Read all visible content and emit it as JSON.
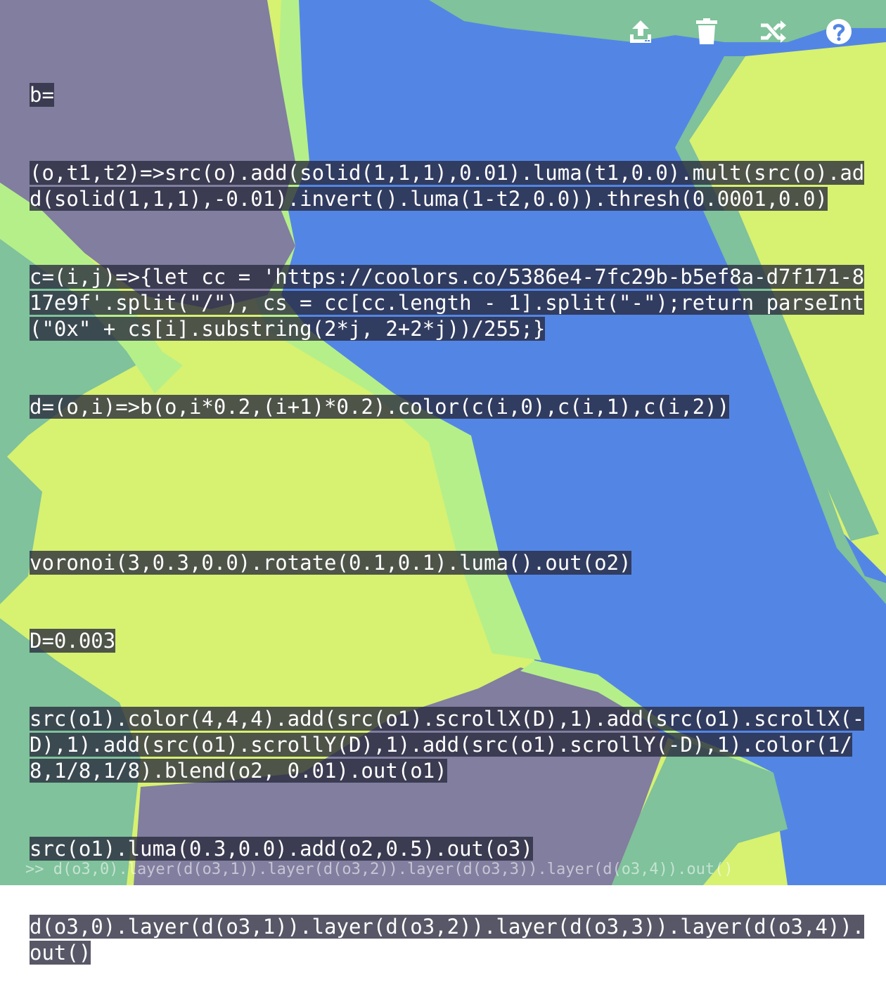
{
  "toolbar": {
    "icons": [
      "upload-icon",
      "trash-icon",
      "shuffle-icon",
      "help-icon"
    ]
  },
  "editor": {
    "lines": [
      "b=",
      "(o,t1,t2)=>src(o).add(solid(1,1,1),0.01).luma(t1,0.0).mult(src(o).add(solid(1,1,1),-0.01).invert().luma(1-t2,0.0)).thresh(0.0001,0.0)",
      "c=(i,j)=>{let cc = 'https://coolors.co/5386e4-7fc29b-b5ef8a-d7f171-817e9f'.split(\"/\"), cs = cc[cc.length - 1].split(\"-\");return parseInt(\"0x\" + cs[i].substring(2*j, 2+2*j))/255;}",
      "d=(o,i)=>b(o,i*0.2,(i+1)*0.2).color(c(i,0),c(i,1),c(i,2))",
      "",
      "voronoi(3,0.3,0.0).rotate(0.1,0.1).luma().out(o2)",
      "D=0.003",
      "src(o1).color(4,4,4).add(src(o1).scrollX(D),1).add(src(o1).scrollX(-D),1).add(src(o1).scrollY(D),1).add(src(o1).scrollY(-D),1).color(1/8,1/8,1/8).blend(o2, 0.01).out(o1)",
      "src(o1).luma(0.3,0.0).add(o2,0.5).out(o3)",
      "d(o3,0).layer(d(o3,1)).layer(d(o3,2)).layer(d(o3,3)).layer(d(o3,4)).out()"
    ]
  },
  "console": {
    "text": ">> d(o3,0).layer(d(o3,1)).layer(d(o3,2)).layer(d(o3,3)).layer(d(o3,4)).out()"
  },
  "palette": {
    "blue": "#5386e4",
    "green": "#7fc29b",
    "light_green": "#b5ef8a",
    "yellow": "#d7f171",
    "purple": "#817e9f"
  }
}
